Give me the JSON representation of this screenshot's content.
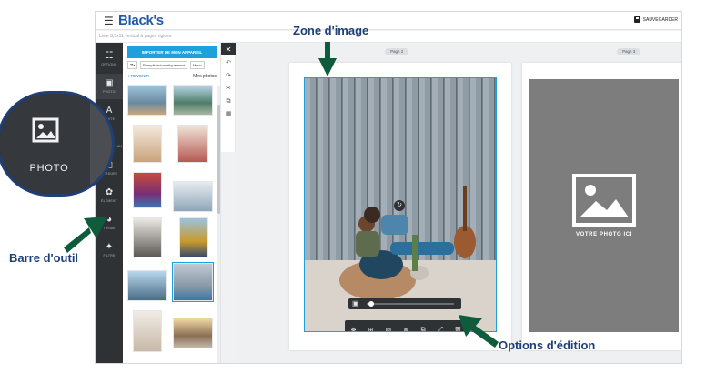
{
  "app": {
    "brand": "Black's",
    "menu_icon": "hamburger-icon",
    "save_label": "SAUVEGARDER",
    "save_icon": "disk-icon",
    "subtitle": "Livre 8,5x11 vertical à pages rigides"
  },
  "rail": {
    "items": [
      {
        "label": "OPTIONS",
        "icon": "sliders-icon"
      },
      {
        "label": "PHOTO",
        "icon": "image-icon"
      },
      {
        "label": "TEXTE",
        "icon": "text-icon"
      },
      {
        "label": "ARRIÈRE-PLAN",
        "icon": "background-icon"
      },
      {
        "label": "BORDURE",
        "icon": "frame-icon"
      },
      {
        "label": "ÉLÉMENT",
        "icon": "element-icon"
      },
      {
        "label": "THÈME",
        "icon": "palette-icon"
      },
      {
        "label": "FILTRE",
        "icon": "sparkle-icon"
      }
    ],
    "magnified_label": "PHOTO"
  },
  "panel": {
    "import_label": "IMPORTER DE MON APPAREIL",
    "filter_label": "Remplir automatiquement",
    "menu_label": "Menu",
    "back_label": "< REVENIR",
    "section_title": "Mes photos"
  },
  "canvas": {
    "page1_label": "Page 2",
    "page2_label": "Page 3",
    "placeholder_text": "VOTRE PHOTO ICI"
  },
  "annotations": {
    "image_zone": "Zone d'image",
    "toolbar": "Barre d'outil",
    "edit_options": "Options d'édition"
  },
  "colors": {
    "accent": "#1ea0dc",
    "annotation": "#1e3f77",
    "arrow": "#0f5c3d",
    "rail": "#2f3235"
  }
}
